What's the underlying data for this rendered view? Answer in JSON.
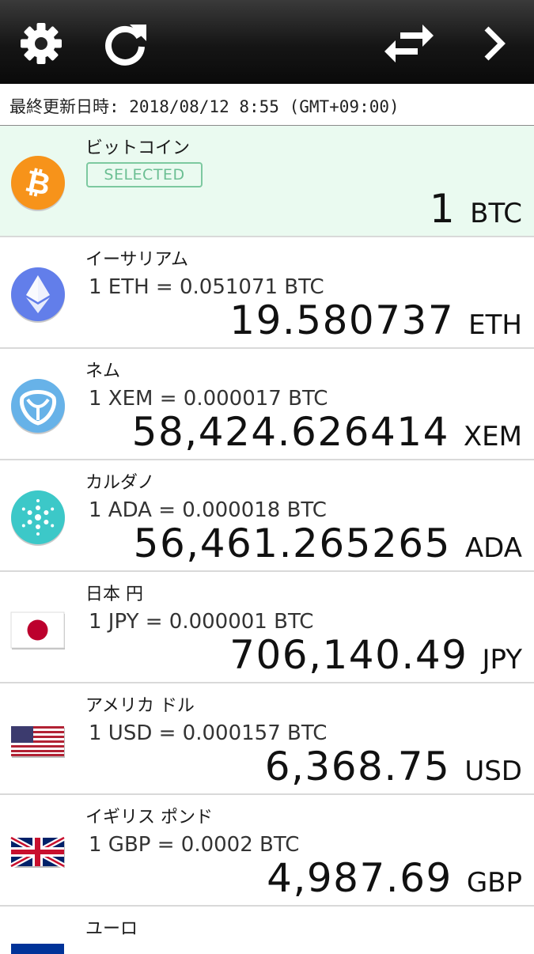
{
  "toolbar": {
    "icons": [
      "gear-icon",
      "refresh-icon",
      "swap-arrows-icon",
      "chevron-right-icon"
    ]
  },
  "status": {
    "last_updated": "最終更新日時: 2018/08/12 8:55 (GMT+09:00)"
  },
  "currencies": [
    {
      "name": "ビットコイン",
      "badge": "SELECTED",
      "amount": "1",
      "unit": "BTC",
      "icon": "bitcoin-icon",
      "color": "#f7931a"
    },
    {
      "name": "イーサリアム",
      "rate": "1 ETH = 0.051071 BTC",
      "amount": "19.580737",
      "unit": "ETH",
      "icon": "ethereum-icon",
      "color": "#627eea"
    },
    {
      "name": "ネム",
      "rate": "1 XEM = 0.000017 BTC",
      "amount": "58,424.626414",
      "unit": "XEM",
      "icon": "nem-icon",
      "color": "#67b2e8"
    },
    {
      "name": "カルダノ",
      "rate": "1 ADA = 0.000018 BTC",
      "amount": "56,461.265265",
      "unit": "ADA",
      "icon": "cardano-icon",
      "color": "#3cc8c8"
    },
    {
      "name": "日本 円",
      "rate": "1 JPY = 0.000001 BTC",
      "amount": "706,140.49",
      "unit": "JPY",
      "icon": "japan-flag-icon",
      "color": "#bc002d"
    },
    {
      "name": "アメリカ ドル",
      "rate": "1 USD = 0.000157 BTC",
      "amount": "6,368.75",
      "unit": "USD",
      "icon": "us-flag-icon",
      "color": "#b22234"
    },
    {
      "name": "イギリス ポンド",
      "rate": "1 GBP = 0.0002 BTC",
      "amount": "4,987.69",
      "unit": "GBP",
      "icon": "uk-flag-icon",
      "color": "#012169"
    },
    {
      "name": "ユーロ",
      "icon": "eu-flag-icon",
      "color": "#003399"
    }
  ]
}
